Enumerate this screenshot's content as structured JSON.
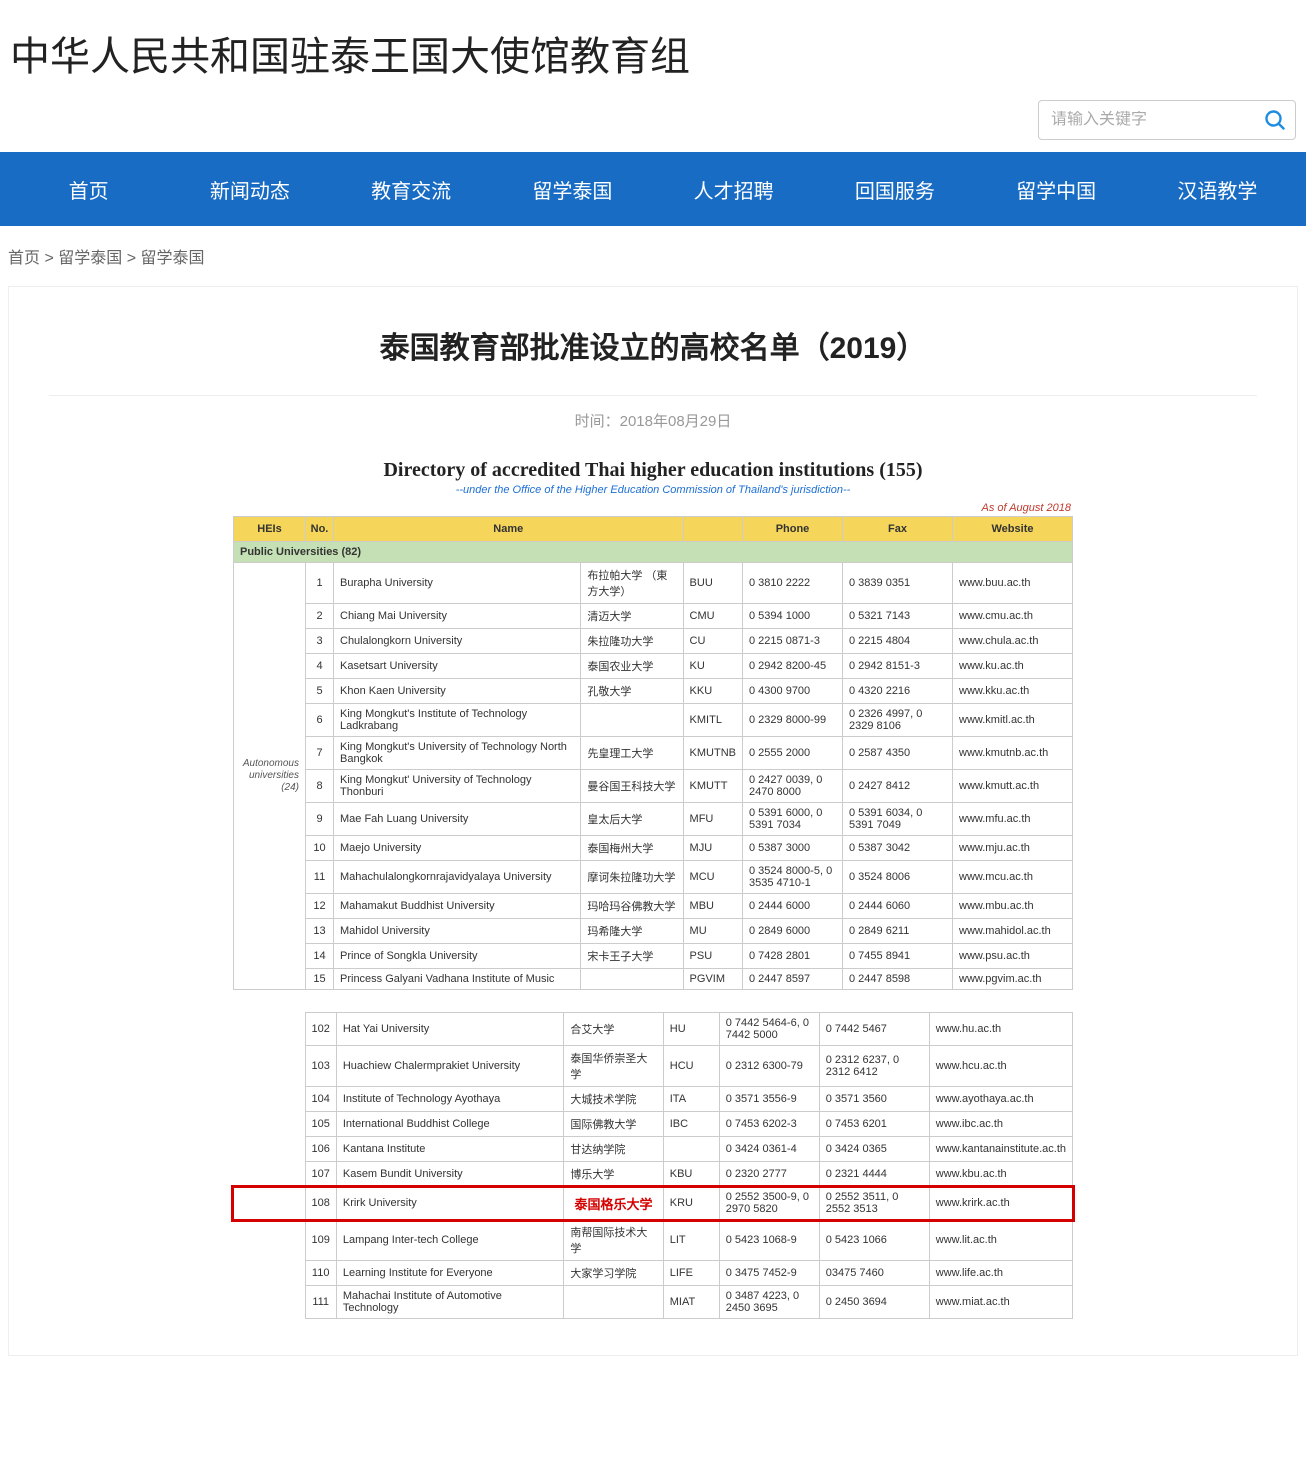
{
  "site_title": "中华人民共和国驻泰王国大使馆教育组",
  "search": {
    "placeholder": "请输入关键字"
  },
  "nav": [
    "首页",
    "新闻动态",
    "教育交流",
    "留学泰国",
    "人才招聘",
    "回国服务",
    "留学中国",
    "汉语教学"
  ],
  "breadcrumb": {
    "home": "首页",
    "cat": "留学泰国",
    "sub": "留学泰国",
    "sep": " > "
  },
  "article": {
    "title": "泰国教育部批准设立的高校名单（2019）",
    "time_label": "时间：",
    "time_value": "2018年08月29日"
  },
  "directory": {
    "title": "Directory of accredited Thai higher education institutions (155)",
    "subtitle": "--under the Office of the Higher Education Commission of Thailand's jurisdiction--",
    "as_of": "As of August 2018",
    "headers": {
      "heis": "HEIs",
      "no": "No.",
      "name": "Name",
      "phone": "Phone",
      "fax": "Fax",
      "website": "Website"
    },
    "section_label": "Public Universities (82)",
    "rowgroup_label_line1": "Autonomous",
    "rowgroup_label_line2": "universities",
    "rowgroup_label_count": "(24)",
    "rows1": [
      {
        "n": 1,
        "en": "Burapha University",
        "cn": "布拉帕大学 （東方大学）",
        "abbr": "BUU",
        "phone": "0 3810 2222",
        "fax": "0 3839 0351",
        "web": "www.buu.ac.th"
      },
      {
        "n": 2,
        "en": "Chiang Mai University",
        "cn": "清迈大学",
        "abbr": "CMU",
        "phone": "0 5394 1000",
        "fax": "0 5321 7143",
        "web": "www.cmu.ac.th"
      },
      {
        "n": 3,
        "en": "Chulalongkorn University",
        "cn": "朱拉隆功大学",
        "abbr": "CU",
        "phone": "0 2215 0871-3",
        "fax": "0 2215 4804",
        "web": "www.chula.ac.th"
      },
      {
        "n": 4,
        "en": "Kasetsart University",
        "cn": "泰国农业大学",
        "abbr": "KU",
        "phone": "0 2942 8200-45",
        "fax": "0 2942 8151-3",
        "web": "www.ku.ac.th"
      },
      {
        "n": 5,
        "en": "Khon Kaen University",
        "cn": "孔敬大学",
        "abbr": "KKU",
        "phone": "0 4300 9700",
        "fax": "0 4320 2216",
        "web": "www.kku.ac.th"
      },
      {
        "n": 6,
        "en": "King Mongkut's Institute of Technology Ladkrabang",
        "cn": "",
        "abbr": "KMITL",
        "phone": "0 2329 8000-99",
        "fax": "0 2326 4997, 0 2329 8106",
        "web": "www.kmitl.ac.th"
      },
      {
        "n": 7,
        "en": "King Mongkut's University of Technology North Bangkok",
        "cn": "先皇理工大学",
        "abbr": "KMUTNB",
        "phone": "0 2555 2000",
        "fax": "0 2587 4350",
        "web": "www.kmutnb.ac.th"
      },
      {
        "n": 8,
        "en": "King Mongkut' University of Technology Thonburi",
        "cn": "曼谷国王科技大学",
        "abbr": "KMUTT",
        "phone": "0 2427 0039, 0 2470 8000",
        "fax": "0 2427 8412",
        "web": "www.kmutt.ac.th"
      },
      {
        "n": 9,
        "en": "Mae Fah Luang University",
        "cn": "皇太后大学",
        "abbr": "MFU",
        "phone": "0 5391 6000, 0 5391 7034",
        "fax": "0 5391 6034, 0 5391 7049",
        "web": "www.mfu.ac.th"
      },
      {
        "n": 10,
        "en": "Maejo University",
        "cn": "泰国梅州大学",
        "abbr": "MJU",
        "phone": "0 5387 3000",
        "fax": "0 5387 3042",
        "web": "www.mju.ac.th"
      },
      {
        "n": 11,
        "en": "Mahachulalongkornrajavidyalaya University",
        "cn": "摩诃朱拉隆功大学",
        "abbr": "MCU",
        "phone": "0 3524 8000-5, 0 3535 4710-1",
        "fax": "0 3524 8006",
        "web": "www.mcu.ac.th"
      },
      {
        "n": 12,
        "en": "Mahamakut Buddhist University",
        "cn": "玛哈玛谷佛教大学",
        "abbr": "MBU",
        "phone": "0 2444 6000",
        "fax": "0 2444 6060",
        "web": "www.mbu.ac.th"
      },
      {
        "n": 13,
        "en": "Mahidol University",
        "cn": "玛希隆大学",
        "abbr": "MU",
        "phone": "0 2849 6000",
        "fax": "0 2849 6211",
        "web": "www.mahidol.ac.th"
      },
      {
        "n": 14,
        "en": "Prince of Songkla University",
        "cn": "宋卡王子大学",
        "abbr": "PSU",
        "phone": "0 7428 2801",
        "fax": "0 7455 8941",
        "web": "www.psu.ac.th"
      },
      {
        "n": 15,
        "en": "Princess Galyani Vadhana Institute of Music",
        "cn": "",
        "abbr": "PGVIM",
        "phone": "0 2447 8597",
        "fax": "0 2447 8598",
        "web": "www.pgvim.ac.th"
      }
    ],
    "rows2": [
      {
        "n": 102,
        "en": "Hat Yai University",
        "cn": "合艾大学",
        "abbr": "HU",
        "phone": "0 7442 5464-6, 0 7442 5000",
        "fax": "0 7442 5467",
        "web": "www.hu.ac.th"
      },
      {
        "n": 103,
        "en": "Huachiew Chalermprakiet University",
        "cn": "泰国华侨崇圣大学",
        "abbr": "HCU",
        "phone": "0 2312 6300-79",
        "fax": "0 2312 6237, 0 2312 6412",
        "web": "www.hcu.ac.th"
      },
      {
        "n": 104,
        "en": "Institute of Technology Ayothaya",
        "cn": "大城技术学院",
        "abbr": "ITA",
        "phone": "0 3571 3556-9",
        "fax": "0 3571 3560",
        "web": "www.ayothaya.ac.th"
      },
      {
        "n": 105,
        "en": "International Buddhist College",
        "cn": "国际佛教大学",
        "abbr": "IBC",
        "phone": "0 7453 6202-3",
        "fax": "0 7453 6201",
        "web": "www.ibc.ac.th"
      },
      {
        "n": 106,
        "en": "Kantana Institute",
        "cn": "甘达纳学院",
        "abbr": "",
        "phone": "0 3424 0361-4",
        "fax": "0 3424 0365",
        "web": "www.kantanainstitute.ac.th"
      },
      {
        "n": 107,
        "en": "Kasem Bundit University",
        "cn": "博乐大学",
        "abbr": "KBU",
        "phone": "0 2320 2777",
        "fax": "0 2321 4444",
        "web": "www.kbu.ac.th"
      },
      {
        "n": 108,
        "en": "Krirk University",
        "cn": "泰国格乐大学",
        "abbr": "KRU",
        "phone": "0 2552 3500-9, 0 2970 5820",
        "fax": "0 2552 3511, 0 2552 3513",
        "web": "www.krirk.ac.th",
        "highlight": true
      },
      {
        "n": 109,
        "en": "Lampang Inter-tech College",
        "cn": "南帮国际技术大学",
        "abbr": "LIT",
        "phone": "0 5423 1068-9",
        "fax": "0 5423 1066",
        "web": "www.lit.ac.th"
      },
      {
        "n": 110,
        "en": "Learning Institute for Everyone",
        "cn": "大家学习学院",
        "abbr": "LIFE",
        "phone": "0 3475 7452-9",
        "fax": "03475 7460",
        "web": "www.life.ac.th"
      },
      {
        "n": 111,
        "en": "Mahachai Institute of Automotive Technology",
        "cn": "",
        "abbr": "MIAT",
        "phone": "0 3487 4223, 0 2450 3695",
        "fax": "0 2450 3694",
        "web": "www.miat.ac.th"
      }
    ]
  }
}
